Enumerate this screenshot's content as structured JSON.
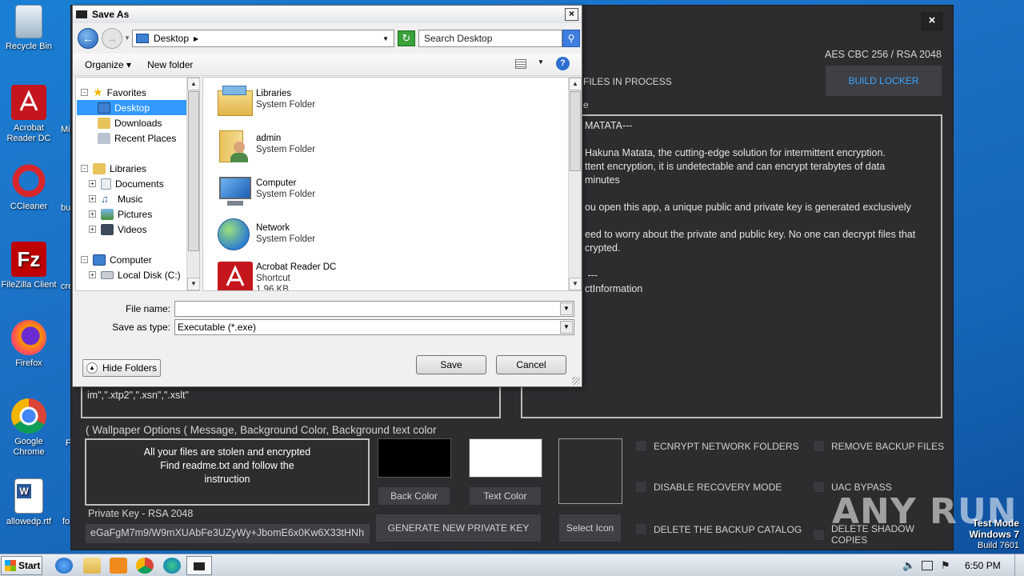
{
  "desktop": {
    "icons": [
      {
        "label": "Recycle Bin"
      },
      {
        "label": "Acrobat Reader DC"
      },
      {
        "label": "CCleaner"
      },
      {
        "label": "FileZilla Client"
      },
      {
        "label": "Firefox"
      },
      {
        "label": "Google Chrome"
      },
      {
        "label": "allowedp.rtf"
      }
    ],
    "partial_labels": [
      "Mic",
      "bu",
      "cre",
      "F",
      "fo"
    ]
  },
  "app": {
    "close_label": "×",
    "encryption_label": "AES CBC 256 / RSA 2048",
    "build_button": "BUILD LOCKER",
    "files_in_process": "FILES IN PROCESS",
    "partial_e": "e",
    "note_text": "MATATA---\n\nHakuna Matata, the cutting-edge solution for intermittent encryption.\nttent encryption, it is undetectable and can encrypt terabytes of data\nminutes\n\nou open this app, a unique public and private key is generated exclusively\n\need to worry about the private and public key. No one can decrypt files that\ncrypted.\n\n ---\nctInformation",
    "extensions_tail": "im\",\".xtp2\",\".xsn\",\".xslt\"",
    "wallpaper_title": "( Wallpaper Options ( Message, Background Color, Background text color",
    "wallpaper_message": "All your files are stolen and encrypted\nFind readme.txt and follow the\ninstruction",
    "back_color_button": "Back Color",
    "text_color_button": "Text Color",
    "back_color": "#000000",
    "text_color": "#ffffff",
    "private_key_label": "Private Key - RSA 2048",
    "private_key_value": "eGaFgM7m9/W9mXUAbFe3UZyWy+JbomE6x0Kw6X33tHNh",
    "generate_button": "GENERATE NEW PRIVATE KEY",
    "select_icon_button": "Select Icon",
    "options": [
      "ECNRYPT NETWORK FOLDERS",
      "REMOVE BACKUP FILES",
      "DISABLE RECOVERY MODE",
      "UAC BYPASS",
      "DELETE THE BACKUP CATALOG",
      "DELETE SHADOW COPIES"
    ]
  },
  "dialog": {
    "title": "Save As",
    "close_label": "×",
    "address": "Desktop",
    "search_placeholder": "Search Desktop",
    "toolbar": {
      "organize": "Organize",
      "new_folder": "New folder"
    },
    "tree": {
      "favorites": "Favorites",
      "desktop": "Desktop",
      "downloads": "Downloads",
      "recent_places": "Recent Places",
      "libraries": "Libraries",
      "documents": "Documents",
      "music": "Music",
      "pictures": "Pictures",
      "videos": "Videos",
      "computer": "Computer",
      "local_disk": "Local Disk (C:)"
    },
    "files": [
      {
        "name": "Libraries",
        "type": "System Folder"
      },
      {
        "name": "admin",
        "type": "System Folder"
      },
      {
        "name": "Computer",
        "type": "System Folder"
      },
      {
        "name": "Network",
        "type": "System Folder"
      },
      {
        "name": "Acrobat Reader DC",
        "type": "Shortcut",
        "size": "1.96 KB"
      }
    ],
    "file_name_label": "File name:",
    "file_name_value": "",
    "save_type_label": "Save as type:",
    "save_type_value": "Executable (*.exe)",
    "save_button": "Save",
    "cancel_button": "Cancel",
    "hide_folders": "Hide Folders"
  },
  "taskbar": {
    "start": "Start",
    "clock": "6:50 PM"
  },
  "watermark": {
    "test_mode": "Test Mode",
    "os": "Windows 7",
    "build": "Build 7601",
    "brand": "ANY RUN"
  }
}
